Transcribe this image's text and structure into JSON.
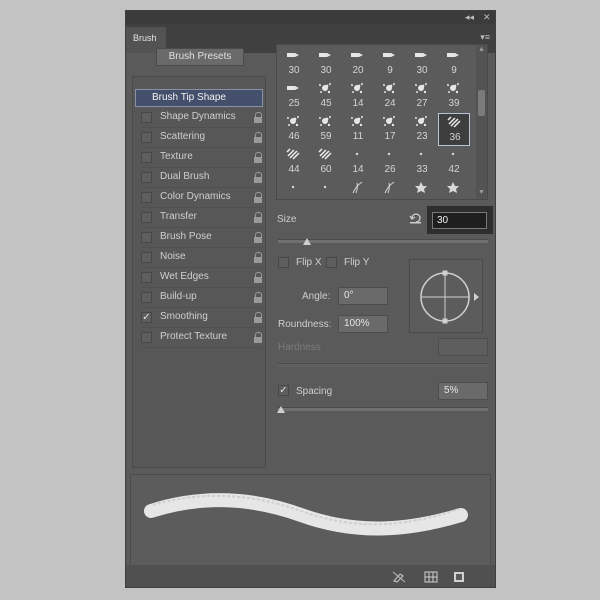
{
  "panel": {
    "tab_label": "Brush",
    "collapse_glyph": "◂◂",
    "close_glyph": "✕",
    "menu_glyph": "▾≡",
    "presets_button": "Brush Presets"
  },
  "options": [
    {
      "label": "Brush Tip Shape",
      "selected": true,
      "checked": false,
      "lock": false
    },
    {
      "label": "Shape Dynamics",
      "checked": false,
      "lock": true
    },
    {
      "label": "Scattering",
      "checked": false,
      "lock": true
    },
    {
      "label": "Texture",
      "checked": false,
      "lock": true
    },
    {
      "label": "Dual Brush",
      "checked": false,
      "lock": true
    },
    {
      "label": "Color Dynamics",
      "checked": false,
      "lock": true
    },
    {
      "label": "Transfer",
      "checked": false,
      "lock": true
    },
    {
      "label": "Brush Pose",
      "checked": false,
      "lock": true
    },
    {
      "label": "Noise",
      "checked": false,
      "lock": true
    },
    {
      "label": "Wet Edges",
      "checked": false,
      "lock": true
    },
    {
      "label": "Build-up",
      "checked": false,
      "lock": true
    },
    {
      "label": "Smoothing",
      "checked": true,
      "lock": true
    },
    {
      "label": "Protect Texture",
      "checked": false,
      "lock": true
    }
  ],
  "tips": [
    {
      "kind": "flat",
      "size": "30"
    },
    {
      "kind": "flat",
      "size": "30"
    },
    {
      "kind": "flat",
      "size": "20"
    },
    {
      "kind": "flat",
      "size": "9"
    },
    {
      "kind": "flat",
      "size": "30"
    },
    {
      "kind": "flat",
      "size": "9"
    },
    {
      "kind": "flat",
      "size": "25"
    },
    {
      "kind": "splatter",
      "size": "45"
    },
    {
      "kind": "splatter",
      "size": "14"
    },
    {
      "kind": "splatter",
      "size": "24"
    },
    {
      "kind": "splatter",
      "size": "27"
    },
    {
      "kind": "splatter",
      "size": "39"
    },
    {
      "kind": "splatter",
      "size": "46"
    },
    {
      "kind": "splatter",
      "size": "59"
    },
    {
      "kind": "splatter",
      "size": "11"
    },
    {
      "kind": "splatter",
      "size": "17"
    },
    {
      "kind": "splatter",
      "size": "23"
    },
    {
      "kind": "hatch",
      "size": "36",
      "selected": true
    },
    {
      "kind": "hatch",
      "size": "44"
    },
    {
      "kind": "hatch",
      "size": "60"
    },
    {
      "kind": "dot",
      "size": "14"
    },
    {
      "kind": "dot",
      "size": "26"
    },
    {
      "kind": "dot",
      "size": "33"
    },
    {
      "kind": "dot",
      "size": "42"
    },
    {
      "kind": "dot",
      "size": ""
    },
    {
      "kind": "dot",
      "size": ""
    },
    {
      "kind": "grass",
      "size": ""
    },
    {
      "kind": "grass",
      "size": ""
    },
    {
      "kind": "leaf",
      "size": ""
    },
    {
      "kind": "leaf",
      "size": ""
    }
  ],
  "size": {
    "label": "Size",
    "value": "30"
  },
  "flip_x": {
    "label": "Flip X",
    "checked": false
  },
  "flip_y": {
    "label": "Flip Y",
    "checked": false
  },
  "angle": {
    "label": "Angle:",
    "value": "0°"
  },
  "roundness": {
    "label": "Roundness:",
    "value": "100%"
  },
  "hardness": {
    "label": "Hardness",
    "value": ""
  },
  "spacing": {
    "label": "Spacing",
    "value": "5%",
    "checked": true
  },
  "check_glyph": "✓",
  "icons": {
    "reset": "reset-icon",
    "toggle_preview": "brush-toggle-icon",
    "grid": "grid-icon",
    "new_preset": "new-preset-icon"
  }
}
